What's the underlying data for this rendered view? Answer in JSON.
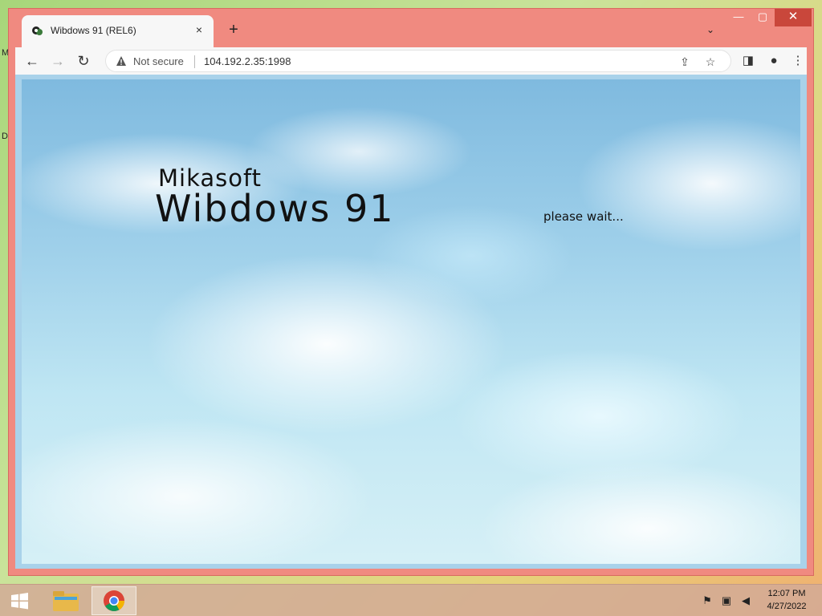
{
  "desktop": {
    "edge_labels": [
      "M",
      "D"
    ]
  },
  "browser": {
    "tab": {
      "title": "Wibdows 91 (REL6)",
      "close_glyph": "×"
    },
    "new_tab_glyph": "+",
    "tab_list_glyph": "⌄",
    "window_controls": {
      "minimize": "—",
      "maximize": "▢",
      "close": "✕"
    },
    "toolbar": {
      "back_glyph": "←",
      "forward_glyph": "→",
      "reload_glyph": "↻",
      "security_label": "Not secure",
      "url": "104.192.2.35:1998",
      "share_glyph": "⇪",
      "star_glyph": "☆",
      "sidepanel_glyph": "◨",
      "profile_glyph": "●",
      "menu_glyph": "⋮"
    }
  },
  "page": {
    "brand_small": "Mikasoft",
    "brand_large": "Wibdows 91",
    "status": "please wait..."
  },
  "taskbar": {
    "tray": {
      "flag_glyph": "⚑",
      "network_glyph": "▣",
      "volume_glyph": "◀"
    },
    "clock": {
      "time": "12:07 PM",
      "date": "4/27/2022"
    }
  },
  "colors": {
    "window_frame": "#f08a80",
    "close_button": "#c9473b",
    "toolbar_bg": "#f7f7f7",
    "sky": "#9fd0ea"
  }
}
